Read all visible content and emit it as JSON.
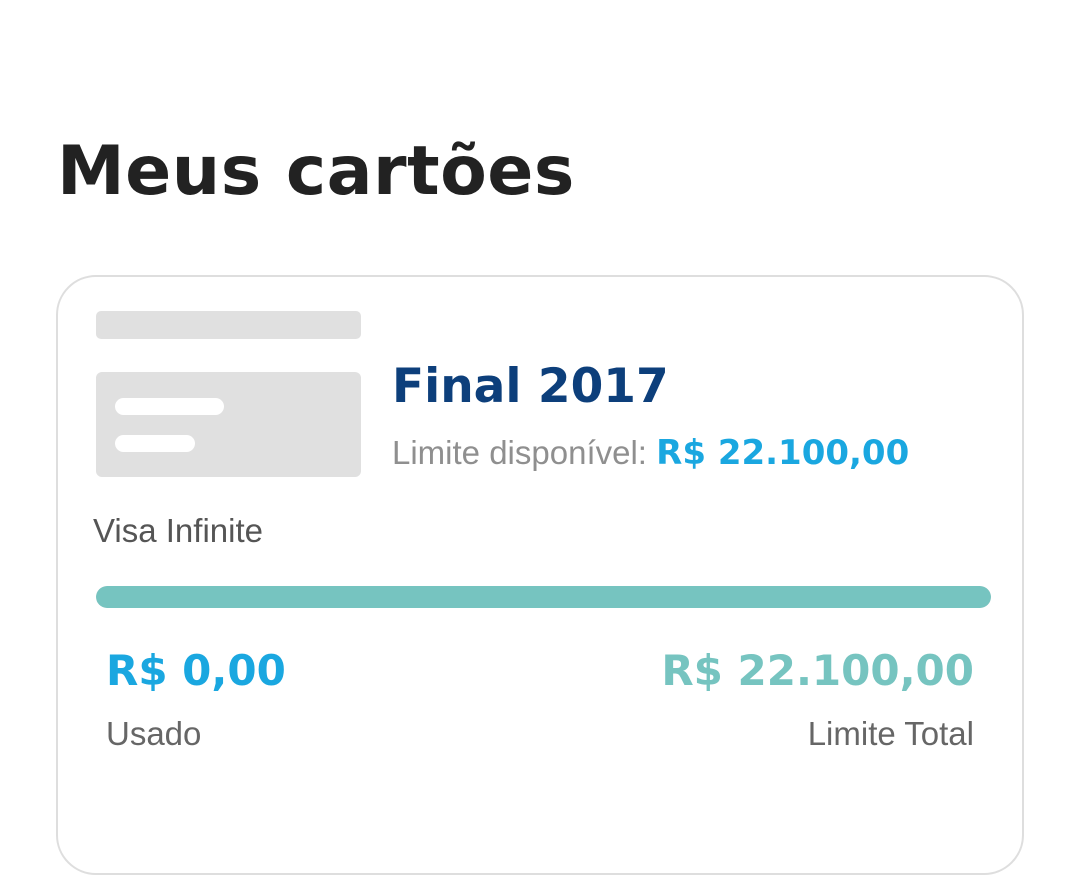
{
  "page": {
    "title": "Meus cartões"
  },
  "card": {
    "final_label": "Final 2017",
    "available_label": "Limite disponível:",
    "available_value": "R$ 22.100,00",
    "brand": "Visa Infinite",
    "used_value": "R$ 0,00",
    "used_label": "Usado",
    "total_value": "R$ 22.100,00",
    "total_label": "Limite Total",
    "available_fraction": 1.0,
    "image_icon": "credit-card-placeholder-icon"
  },
  "colors": {
    "title": "#222222",
    "final": "#0d3f7b",
    "accent_blue": "#1aa7e0",
    "accent_teal": "#76c4c0",
    "muted_text": "#8f8f8f",
    "card_border": "#dedede",
    "placeholder": "#e0e0e0"
  }
}
